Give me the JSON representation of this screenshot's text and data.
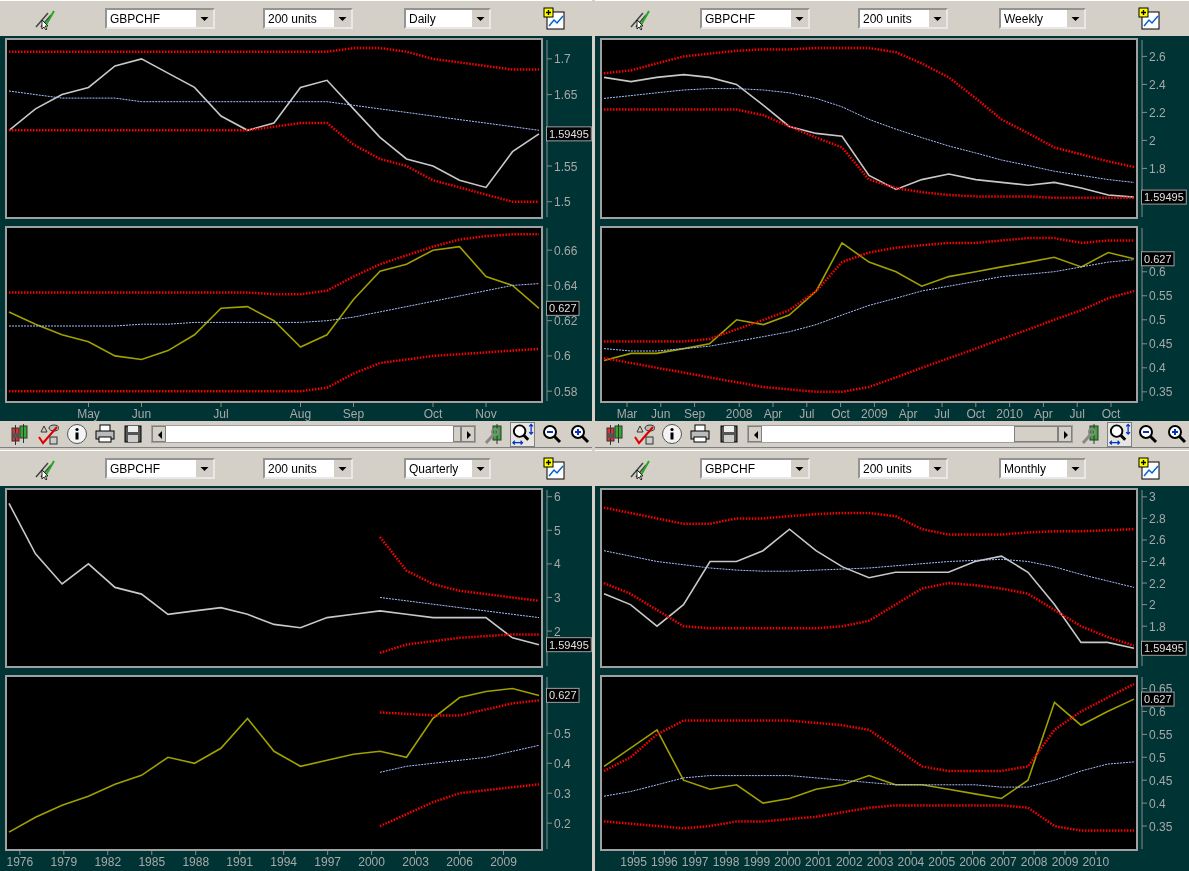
{
  "panels": [
    {
      "toolbar": {
        "symbol": "GBPCHF",
        "size": "200 units",
        "period": "Daily"
      },
      "price_chart": {
        "reading": "1.59495",
        "chart_data": {
          "type": "line",
          "ylim": [
            1.48,
            1.725
          ],
          "yticks": [
            1.7,
            1.65,
            1.55,
            1.5
          ],
          "series": [
            {
              "color": "#c8c8c8",
              "line_style": "solid",
              "values": [
                1.6,
                1.63,
                1.65,
                1.66,
                1.69,
                1.7,
                1.68,
                1.66,
                1.62,
                1.6,
                1.61,
                1.66,
                1.67,
                1.63,
                1.59,
                1.56,
                1.55,
                1.53,
                1.52,
                1.57,
                1.595
              ]
            },
            {
              "color": "#ff0000",
              "line_style": "dotted",
              "values": [
                1.71,
                1.71,
                1.71,
                1.71,
                1.71,
                1.71,
                1.71,
                1.71,
                1.71,
                1.71,
                1.71,
                1.71,
                1.71,
                1.715,
                1.715,
                1.71,
                1.7,
                1.695,
                1.69,
                1.685,
                1.685
              ]
            },
            {
              "color": "#a8c0ff",
              "line_style": "dashed",
              "values": [
                1.655,
                1.65,
                1.645,
                1.645,
                1.645,
                1.64,
                1.64,
                1.64,
                1.64,
                1.64,
                1.64,
                1.64,
                1.64,
                1.635,
                1.63,
                1.625,
                1.62,
                1.615,
                1.61,
                1.605,
                1.6
              ]
            },
            {
              "color": "#ff0000",
              "line_style": "dotted",
              "values": [
                1.6,
                1.6,
                1.6,
                1.6,
                1.6,
                1.6,
                1.6,
                1.6,
                1.6,
                1.6,
                1.605,
                1.61,
                1.61,
                1.58,
                1.56,
                1.55,
                1.53,
                1.52,
                1.51,
                1.5,
                1.5
              ]
            }
          ]
        }
      },
      "indicator_chart": {
        "reading": "0.627",
        "chart_data": {
          "type": "line",
          "categories": [
            null,
            null,
            null,
            "May",
            null,
            "Jun",
            null,
            null,
            "Jul",
            null,
            null,
            "Aug",
            null,
            "Sep",
            null,
            null,
            "Oct",
            null,
            "Nov",
            null,
            null
          ],
          "ylim": [
            0.575,
            0.672
          ],
          "yticks": [
            0.66,
            0.64,
            0.62,
            0.6,
            0.58
          ],
          "series": [
            {
              "color": "#a0a000",
              "line_style": "solid",
              "values": [
                0.625,
                0.618,
                0.612,
                0.608,
                0.6,
                0.598,
                0.603,
                0.612,
                0.627,
                0.628,
                0.62,
                0.605,
                0.612,
                0.632,
                0.648,
                0.652,
                0.66,
                0.662,
                0.645,
                0.64,
                0.627
              ]
            },
            {
              "color": "#ff0000",
              "line_style": "dotted",
              "values": [
                0.636,
                0.636,
                0.636,
                0.636,
                0.636,
                0.636,
                0.636,
                0.636,
                0.636,
                0.636,
                0.635,
                0.635,
                0.637,
                0.645,
                0.652,
                0.657,
                0.662,
                0.666,
                0.668,
                0.669,
                0.669
              ]
            },
            {
              "color": "#a8c0ff",
              "line_style": "dashed",
              "values": [
                0.617,
                0.617,
                0.617,
                0.617,
                0.617,
                0.618,
                0.618,
                0.619,
                0.619,
                0.619,
                0.619,
                0.619,
                0.62,
                0.622,
                0.625,
                0.628,
                0.631,
                0.634,
                0.637,
                0.64,
                0.641
              ]
            },
            {
              "color": "#ff0000",
              "line_style": "dotted",
              "values": [
                0.58,
                0.58,
                0.58,
                0.58,
                0.58,
                0.58,
                0.58,
                0.58,
                0.58,
                0.58,
                0.58,
                0.58,
                0.582,
                0.59,
                0.596,
                0.598,
                0.6,
                0.601,
                0.602,
                0.603,
                0.604
              ]
            }
          ]
        }
      },
      "scroll_toolbar": {
        "autoscale_pressed": true
      }
    },
    {
      "toolbar": {
        "symbol": "GBPCHF",
        "size": "200 units",
        "period": "Weekly"
      },
      "price_chart": {
        "reading": "1.59495",
        "chart_data": {
          "type": "line",
          "x": [
            2007.0,
            2007.2,
            2007.39,
            2007.59,
            2007.78,
            2007.98,
            2008.18,
            2008.37,
            2008.57,
            2008.76,
            2008.96,
            2009.16,
            2009.35,
            2009.55,
            2009.75,
            2009.94,
            2010.14,
            2010.33,
            2010.53,
            2010.73,
            2010.92
          ],
          "xlim": [
            2007.0,
            2010.92
          ],
          "ylim": [
            1.46,
            2.71
          ],
          "yticks": [
            2.6,
            2.4,
            2.2,
            2,
            1.8
          ],
          "series": [
            {
              "color": "#c8c8c8",
              "line_style": "solid",
              "values": [
                2.45,
                2.42,
                2.45,
                2.47,
                2.45,
                2.4,
                2.25,
                2.1,
                2.05,
                2.03,
                1.75,
                1.65,
                1.72,
                1.76,
                1.72,
                1.7,
                1.68,
                1.7,
                1.66,
                1.61,
                1.595
              ]
            },
            {
              "color": "#ff0000",
              "line_style": "dotted",
              "values": [
                2.48,
                2.5,
                2.55,
                2.6,
                2.62,
                2.64,
                2.65,
                2.65,
                2.66,
                2.66,
                2.66,
                2.63,
                2.55,
                2.45,
                2.3,
                2.15,
                2.05,
                1.95,
                1.9,
                1.85,
                1.81
              ]
            },
            {
              "color": "#a8c0ff",
              "line_style": "dashed",
              "values": [
                2.3,
                2.32,
                2.34,
                2.36,
                2.37,
                2.37,
                2.36,
                2.34,
                2.3,
                2.24,
                2.15,
                2.08,
                2.02,
                1.96,
                1.91,
                1.86,
                1.82,
                1.78,
                1.75,
                1.72,
                1.7
              ]
            },
            {
              "color": "#ff0000",
              "line_style": "dotted",
              "values": [
                2.22,
                2.22,
                2.22,
                2.22,
                2.22,
                2.22,
                2.18,
                2.1,
                2.02,
                1.95,
                1.72,
                1.66,
                1.63,
                1.61,
                1.6,
                1.6,
                1.6,
                1.59,
                1.59,
                1.59,
                1.59
              ]
            }
          ]
        }
      },
      "indicator_chart": {
        "reading": "0.627",
        "chart_data": {
          "type": "line",
          "x": [
            2007.0,
            2007.2,
            2007.39,
            2007.59,
            2007.78,
            2007.98,
            2008.18,
            2008.37,
            2008.57,
            2008.76,
            2008.96,
            2009.16,
            2009.35,
            2009.55,
            2009.75,
            2009.94,
            2010.14,
            2010.33,
            2010.53,
            2010.73,
            2010.92
          ],
          "xlim": [
            2007.0,
            2010.92
          ],
          "ylim": [
            0.333,
            0.689
          ],
          "yticks": [
            0.6,
            0.55,
            0.5,
            0.45,
            0.4,
            0.35
          ],
          "xticks": [
            {
              "value": 2007.17,
              "label": "Mar"
            },
            {
              "value": 2007.42,
              "label": "Jun"
            },
            {
              "value": 2007.67,
              "label": "Sep"
            },
            2008,
            {
              "value": 2008.25,
              "label": "Apr"
            },
            {
              "value": 2008.5,
              "label": "Jul"
            },
            {
              "value": 2008.75,
              "label": "Oct"
            },
            2009,
            {
              "value": 2009.25,
              "label": "Apr"
            },
            {
              "value": 2009.5,
              "label": "Jul"
            },
            {
              "value": 2009.75,
              "label": "Oct"
            },
            2010,
            {
              "value": 2010.25,
              "label": "Apr"
            },
            {
              "value": 2010.5,
              "label": "Jul"
            },
            {
              "value": 2010.75,
              "label": "Oct"
            }
          ],
          "series": [
            {
              "color": "#a0a000",
              "line_style": "solid",
              "values": [
                0.415,
                0.43,
                0.43,
                0.44,
                0.45,
                0.5,
                0.49,
                0.51,
                0.56,
                0.66,
                0.62,
                0.6,
                0.57,
                0.59,
                0.6,
                0.61,
                0.62,
                0.63,
                0.61,
                0.64,
                0.627
              ]
            },
            {
              "color": "#ff0000",
              "line_style": "dotted",
              "values": [
                0.455,
                0.455,
                0.455,
                0.455,
                0.46,
                0.48,
                0.5,
                0.52,
                0.56,
                0.62,
                0.64,
                0.65,
                0.655,
                0.66,
                0.66,
                0.665,
                0.67,
                0.67,
                0.66,
                0.665,
                0.665
              ]
            },
            {
              "color": "#a8c0ff",
              "line_style": "dashed",
              "values": [
                0.44,
                0.435,
                0.435,
                0.44,
                0.445,
                0.455,
                0.465,
                0.475,
                0.49,
                0.51,
                0.53,
                0.545,
                0.56,
                0.57,
                0.58,
                0.59,
                0.595,
                0.6,
                0.61,
                0.62,
                0.625
              ]
            },
            {
              "color": "#ff0000",
              "line_style": "dotted",
              "values": [
                0.42,
                0.41,
                0.4,
                0.39,
                0.38,
                0.37,
                0.36,
                0.355,
                0.35,
                0.35,
                0.36,
                0.38,
                0.4,
                0.42,
                0.44,
                0.46,
                0.48,
                0.5,
                0.52,
                0.545,
                0.56
              ]
            }
          ]
        }
      },
      "scroll_toolbar": {
        "autoscale_pressed": true
      }
    },
    {
      "toolbar": {
        "symbol": "GBPCHF",
        "size": "200 units",
        "period": "Quarterly"
      },
      "price_chart": {
        "reading": "1.59495",
        "chart_data": {
          "type": "line",
          "x": [
            1975.26,
            1977.07,
            1978.88,
            1980.68,
            1982.49,
            1984.3,
            1986.11,
            1987.92,
            1989.72,
            1991.53,
            1993.34,
            1995.15,
            1996.96,
            1998.76,
            2000.57,
            2002.38,
            2004.19,
            2006.0,
            2007.8,
            2009.61,
            2011.42
          ],
          "xlim": [
            1975.26,
            2011.42
          ],
          "ylim": [
            0.99,
            6.17
          ],
          "yticks": [
            6,
            5,
            4,
            3,
            2
          ],
          "series": [
            {
              "color": "#c8c8c8",
              "line_style": "solid",
              "values": [
                5.8,
                4.3,
                3.4,
                4.0,
                3.3,
                3.1,
                2.5,
                2.6,
                2.7,
                2.5,
                2.2,
                2.1,
                2.4,
                2.5,
                2.6,
                2.5,
                2.4,
                2.4,
                2.4,
                1.8,
                1.595
              ]
            },
            {
              "color": "#ff0000",
              "line_style": "dotted",
              "values": [
                null,
                null,
                null,
                null,
                null,
                null,
                null,
                null,
                null,
                null,
                null,
                null,
                null,
                null,
                4.8,
                3.8,
                3.4,
                3.2,
                3.1,
                3.0,
                2.9
              ]
            },
            {
              "color": "#a8c0ff",
              "line_style": "dashed",
              "values": [
                null,
                null,
                null,
                null,
                null,
                null,
                null,
                null,
                null,
                null,
                null,
                null,
                null,
                null,
                3.0,
                2.9,
                2.8,
                2.7,
                2.6,
                2.5,
                2.4
              ]
            },
            {
              "color": "#ff0000",
              "line_style": "dotted",
              "values": [
                null,
                null,
                null,
                null,
                null,
                null,
                null,
                null,
                null,
                null,
                null,
                null,
                null,
                null,
                1.35,
                1.6,
                1.7,
                1.8,
                1.85,
                1.9,
                1.9
              ]
            }
          ]
        }
      },
      "indicator_chart": {
        "reading": "0.627",
        "chart_data": {
          "type": "line",
          "x": [
            1975.26,
            1977.07,
            1978.88,
            1980.68,
            1982.49,
            1984.3,
            1986.11,
            1987.92,
            1989.72,
            1991.53,
            1993.34,
            1995.15,
            1996.96,
            1998.76,
            2000.57,
            2002.38,
            2004.19,
            2006.0,
            2007.8,
            2009.61,
            2011.42
          ],
          "xlim": [
            1975.26,
            2011.42
          ],
          "ylim": [
            0.117,
            0.685
          ],
          "yticks": [
            0.5,
            0.4,
            0.3,
            0.2
          ],
          "xticks": [
            1976,
            1979,
            1982,
            1985,
            1988,
            1991,
            1994,
            1997,
            2000,
            2003,
            2006,
            2009
          ],
          "series": [
            {
              "color": "#a0a000",
              "line_style": "solid",
              "values": [
                0.17,
                0.22,
                0.26,
                0.29,
                0.33,
                0.36,
                0.42,
                0.4,
                0.45,
                0.55,
                0.44,
                0.39,
                0.41,
                0.43,
                0.44,
                0.42,
                0.55,
                0.62,
                0.64,
                0.65,
                0.627
              ]
            },
            {
              "color": "#ff0000",
              "line_style": "dotted",
              "values": [
                null,
                null,
                null,
                null,
                null,
                null,
                null,
                null,
                null,
                null,
                null,
                null,
                null,
                null,
                0.57,
                0.565,
                0.56,
                0.56,
                0.58,
                0.6,
                0.61
              ]
            },
            {
              "color": "#a8c0ff",
              "line_style": "dashed",
              "values": [
                null,
                null,
                null,
                null,
                null,
                null,
                null,
                null,
                null,
                null,
                null,
                null,
                null,
                null,
                0.37,
                0.39,
                0.4,
                0.41,
                0.42,
                0.44,
                0.46
              ]
            },
            {
              "color": "#ff0000",
              "line_style": "dotted",
              "values": [
                null,
                null,
                null,
                null,
                null,
                null,
                null,
                null,
                null,
                null,
                null,
                null,
                null,
                null,
                0.19,
                0.23,
                0.27,
                0.3,
                0.31,
                0.32,
                0.33
              ]
            }
          ]
        }
      }
    },
    {
      "toolbar": {
        "symbol": "GBPCHF",
        "size": "200 units",
        "period": "Monthly"
      },
      "price_chart": {
        "reading": "1.59495",
        "chart_data": {
          "type": "line",
          "x": [
            1994.04,
            1994.9,
            1995.76,
            1996.62,
            1997.48,
            1998.34,
            1999.2,
            2000.06,
            2000.92,
            2001.78,
            2002.64,
            2003.5,
            2004.36,
            2005.22,
            2006.08,
            2006.94,
            2007.8,
            2008.66,
            2009.52,
            2010.38,
            2011.24
          ],
          "xlim": [
            1994.04,
            2011.24
          ],
          "ylim": [
            1.44,
            3.054
          ],
          "yticks": [
            3,
            2.8,
            2.6,
            2.4,
            2.2,
            2,
            1.8
          ],
          "series": [
            {
              "color": "#c8c8c8",
              "line_style": "solid",
              "values": [
                2.1,
                2.0,
                1.8,
                2.0,
                2.4,
                2.4,
                2.5,
                2.7,
                2.5,
                2.35,
                2.25,
                2.3,
                2.3,
                2.3,
                2.4,
                2.45,
                2.3,
                2.0,
                1.65,
                1.65,
                1.595
              ]
            },
            {
              "color": "#ff0000",
              "line_style": "dotted",
              "values": [
                2.9,
                2.85,
                2.8,
                2.75,
                2.75,
                2.8,
                2.8,
                2.82,
                2.84,
                2.85,
                2.85,
                2.82,
                2.7,
                2.65,
                2.65,
                2.65,
                2.67,
                2.68,
                2.68,
                2.69,
                2.7
              ]
            },
            {
              "color": "#a8c0ff",
              "line_style": "dashed",
              "values": [
                2.5,
                2.45,
                2.4,
                2.37,
                2.34,
                2.32,
                2.31,
                2.31,
                2.32,
                2.33,
                2.34,
                2.36,
                2.38,
                2.4,
                2.41,
                2.42,
                2.4,
                2.35,
                2.28,
                2.22,
                2.16
              ]
            },
            {
              "color": "#ff0000",
              "line_style": "dotted",
              "values": [
                2.2,
                2.1,
                1.95,
                1.8,
                1.78,
                1.78,
                1.78,
                1.78,
                1.78,
                1.8,
                1.85,
                2.0,
                2.15,
                2.2,
                2.18,
                2.15,
                2.1,
                1.95,
                1.8,
                1.7,
                1.62
              ]
            }
          ]
        }
      },
      "indicator_chart": {
        "reading": "0.627",
        "chart_data": {
          "type": "line",
          "x": [
            1994.04,
            1994.9,
            1995.76,
            1996.62,
            1997.48,
            1998.34,
            1999.2,
            2000.06,
            2000.92,
            2001.78,
            2002.64,
            2003.5,
            2004.36,
            2005.22,
            2006.08,
            2006.94,
            2007.8,
            2008.66,
            2009.52,
            2010.38,
            2011.24
          ],
          "xlim": [
            1994.04,
            2011.24
          ],
          "ylim": [
            0.302,
            0.673
          ],
          "yticks": [
            0.65,
            0.6,
            0.55,
            0.5,
            0.45,
            0.4,
            0.35
          ],
          "xticks": [
            1995,
            1996,
            1997,
            1998,
            1999,
            2000,
            2001,
            2002,
            2003,
            2004,
            2005,
            2006,
            2007,
            2008,
            2009,
            2010
          ],
          "series": [
            {
              "color": "#a0a000",
              "line_style": "solid",
              "values": [
                0.48,
                0.52,
                0.56,
                0.45,
                0.43,
                0.44,
                0.4,
                0.41,
                0.43,
                0.44,
                0.46,
                0.44,
                0.44,
                0.43,
                0.42,
                0.41,
                0.45,
                0.62,
                0.57,
                0.6,
                0.627
              ]
            },
            {
              "color": "#ff0000",
              "line_style": "dotted",
              "values": [
                0.47,
                0.5,
                0.55,
                0.58,
                0.58,
                0.58,
                0.58,
                0.58,
                0.575,
                0.57,
                0.56,
                0.52,
                0.48,
                0.47,
                0.47,
                0.47,
                0.48,
                0.56,
                0.6,
                0.63,
                0.66
              ]
            },
            {
              "color": "#a8c0ff",
              "line_style": "dashed",
              "values": [
                0.415,
                0.425,
                0.44,
                0.455,
                0.46,
                0.46,
                0.46,
                0.46,
                0.455,
                0.45,
                0.445,
                0.44,
                0.44,
                0.44,
                0.44,
                0.435,
                0.435,
                0.45,
                0.47,
                0.485,
                0.49
              ]
            },
            {
              "color": "#ff0000",
              "line_style": "dotted",
              "values": [
                0.36,
                0.355,
                0.35,
                0.345,
                0.35,
                0.36,
                0.36,
                0.365,
                0.37,
                0.38,
                0.39,
                0.395,
                0.395,
                0.395,
                0.395,
                0.395,
                0.39,
                0.35,
                0.34,
                0.34,
                0.34
              ]
            }
          ]
        }
      }
    }
  ]
}
